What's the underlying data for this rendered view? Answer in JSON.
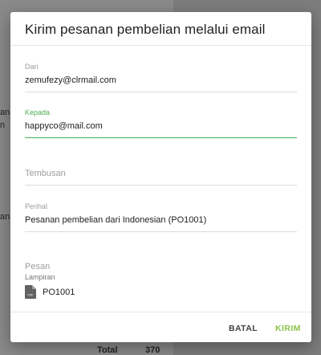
{
  "background": {
    "side_text_1": "an:",
    "side_text_2": "n",
    "side_text_3": "an",
    "total_label": "Total",
    "total_value": "370"
  },
  "dialog": {
    "title": "Kirim pesanan pembelian melalui email",
    "from": {
      "label": "Dari",
      "value": "zemufezy@clrmail.com"
    },
    "to": {
      "label": "Kepada",
      "value": "happyco@mail.com"
    },
    "cc": {
      "placeholder": "Tembusan"
    },
    "subject": {
      "label": "Perihal",
      "value": "Pesanan pembelian dari Indonesian (PO1001)"
    },
    "message": {
      "placeholder": "Pesan"
    },
    "attachments": {
      "label": "Lampiran",
      "items": [
        {
          "name": "PO1001",
          "icon": "pdf-file-icon"
        }
      ]
    },
    "actions": {
      "cancel": "BATAL",
      "send": "KIRIM"
    },
    "colors": {
      "accent": "#4caf50",
      "send": "#8bc34a"
    }
  }
}
